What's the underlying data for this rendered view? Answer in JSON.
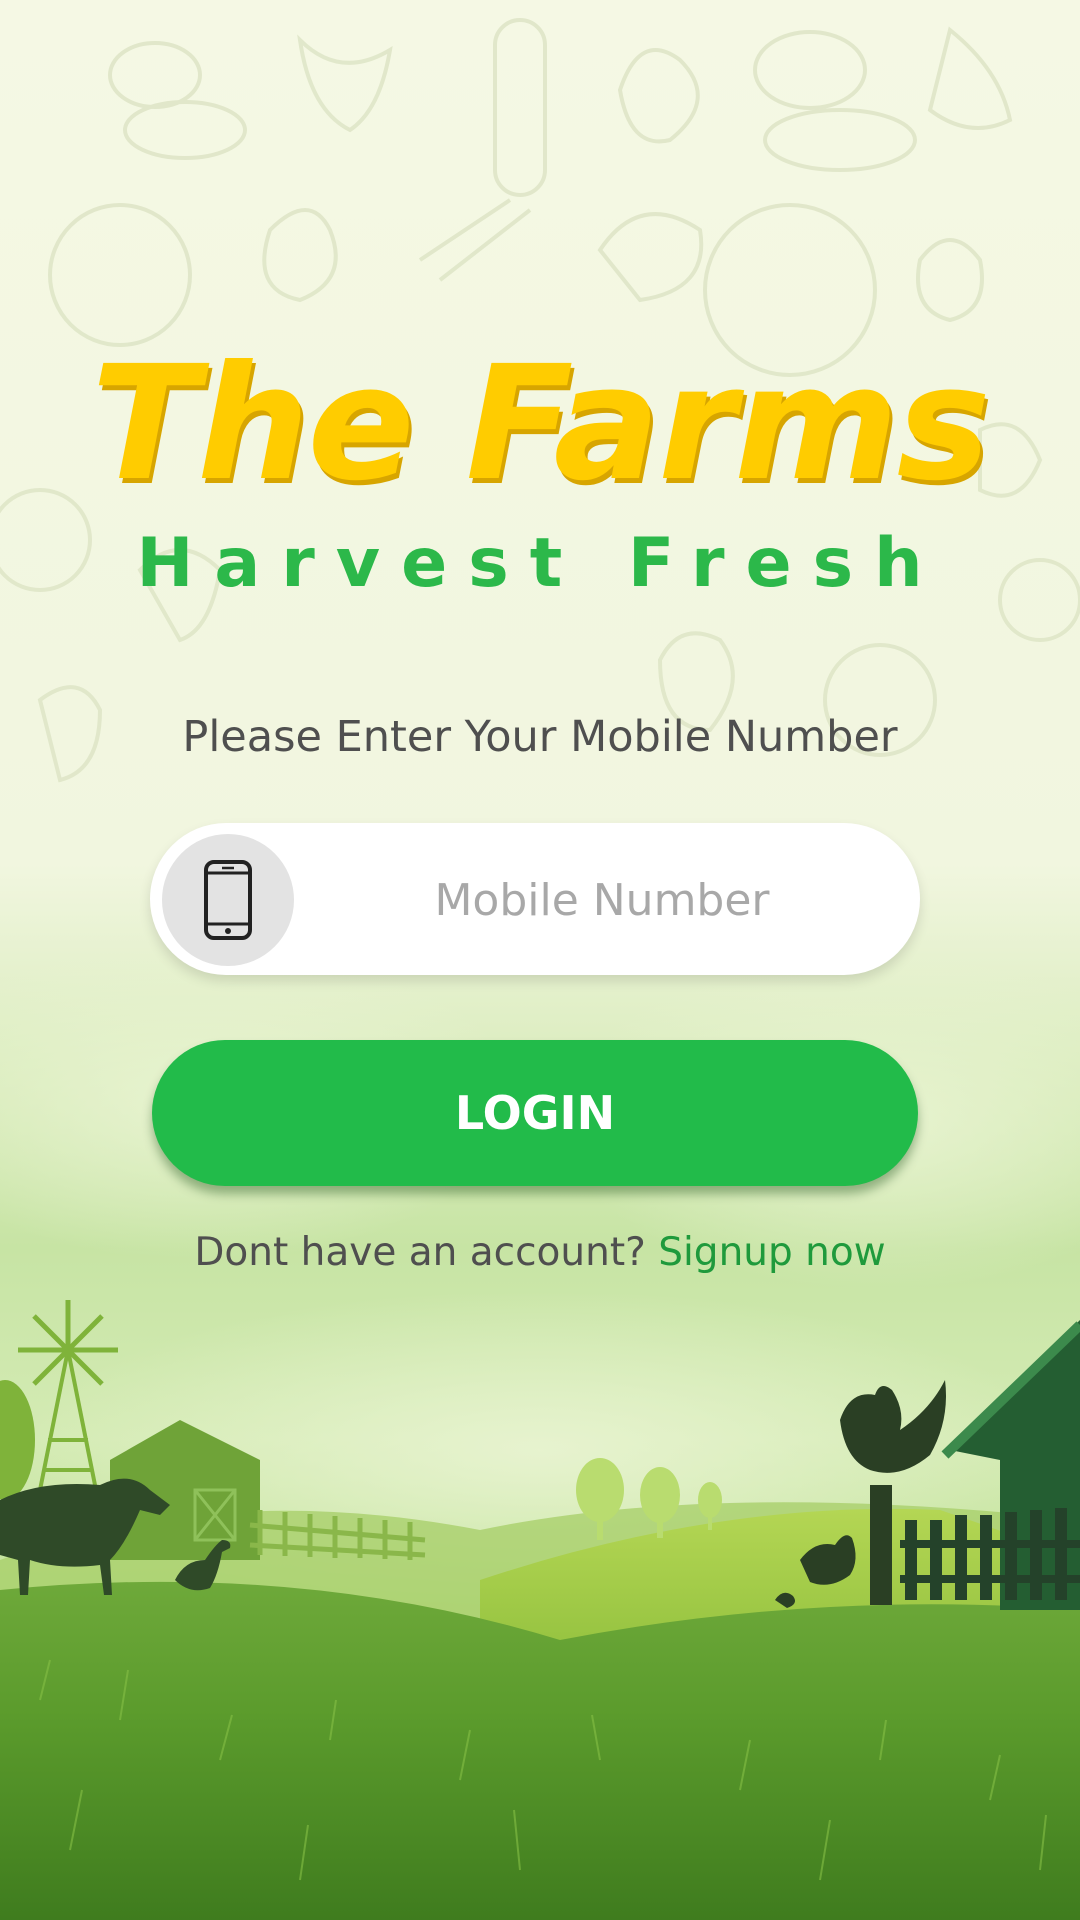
{
  "brand": {
    "title": "The Farms",
    "subtitle": "Harvest Fresh",
    "title_color": "#ffcc00",
    "subtitle_color": "#2cb84a"
  },
  "login_form": {
    "prompt": "Please Enter Your Mobile Number",
    "mobile_placeholder": "Mobile Number",
    "mobile_value": "",
    "input_icon": "smartphone-icon",
    "login_label": "LOGIN",
    "accent_color": "#22bb4a"
  },
  "signup": {
    "question": "Dont have an account? ",
    "link_label": "Signup now"
  },
  "background": {
    "pattern": "vegetable-doodle-pattern",
    "scene": "farm-landscape-illustration"
  }
}
